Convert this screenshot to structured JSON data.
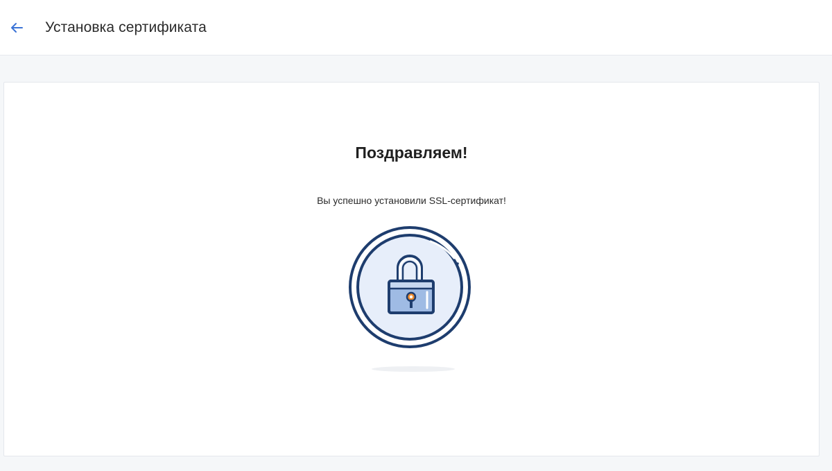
{
  "header": {
    "title": "Установка сертификата",
    "back_icon": "arrow-left-icon"
  },
  "content": {
    "heading": "Поздравляем!",
    "message": "Вы успешно установили SSL-сертификат!",
    "illustration_icon": "padlock-icon"
  },
  "colors": {
    "accent_blue": "#3b73d6",
    "lock_outline": "#1e3d6e",
    "lock_fill": "#9fbbe4",
    "circle_fill": "#e7eefa",
    "keyhole": "#ee8b2c"
  }
}
